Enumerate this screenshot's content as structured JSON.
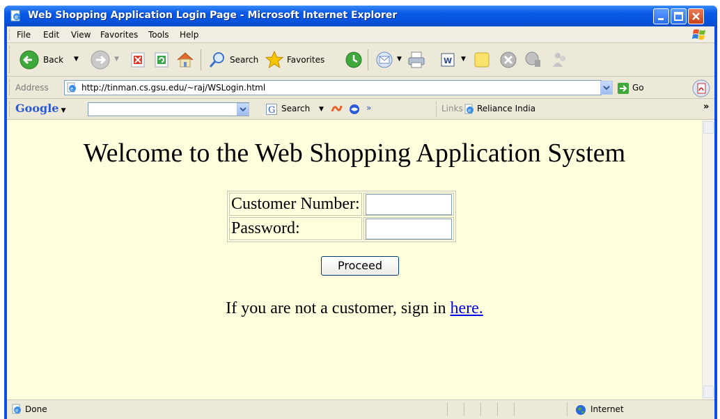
{
  "window": {
    "title": "Web Shopping Application Login Page - Microsoft Internet Explorer"
  },
  "menubar": {
    "items": [
      "File",
      "Edit",
      "View",
      "Favorites",
      "Tools",
      "Help"
    ]
  },
  "toolbar": {
    "back_label": "Back",
    "search_label": "Search",
    "favorites_label": "Favorites"
  },
  "address_bar": {
    "label": "Address",
    "url": "http://tinman.cs.gsu.edu/~raj/WSLogin.html",
    "go_label": "Go"
  },
  "google_bar": {
    "logo": "Google",
    "search_value": "",
    "search_label": "Search",
    "more_glyph": "»",
    "links_label": "Links",
    "link_item": "Reliance India",
    "chevron": "»"
  },
  "page": {
    "heading": "Welcome to the Web Shopping Application System",
    "customer_number_label": "Customer Number:",
    "customer_number_value": "",
    "password_label": "Password:",
    "password_value": "",
    "proceed_label": "Proceed",
    "signin_text": "If you are not a customer, sign in ",
    "signin_link": "here."
  },
  "status_bar": {
    "status": "Done",
    "zone": "Internet"
  },
  "colors": {
    "title_bar": "#0a5ae8",
    "page_background": "#ffffde",
    "link": "#0000ee"
  }
}
